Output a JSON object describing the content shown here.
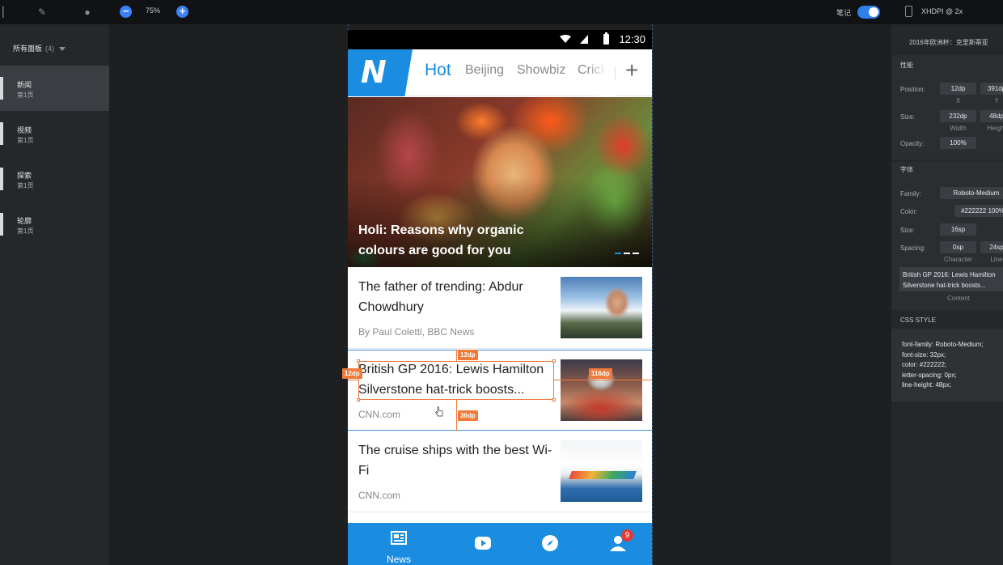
{
  "toolbar": {
    "zoom": "75%",
    "notes_label": "笔记"
  },
  "left_panel": {
    "header": "所有面板",
    "count": "(4)",
    "boards": [
      {
        "name": "新闻",
        "page": "第1页"
      },
      {
        "name": "视频",
        "page": "第1页"
      },
      {
        "name": "探索",
        "page": "第1页"
      },
      {
        "name": "轮廓",
        "page": "第1页"
      }
    ]
  },
  "right_panel": {
    "device": "XHDPI @ 2x",
    "title": "2016年欧洲杯：克里斯蒂亚",
    "props_section": "性能",
    "position_label": "Position:",
    "position_x": "12dp",
    "position_y": "391dp",
    "x_label": "X",
    "y_label": "Y",
    "size_label": "Size:",
    "size_w": "232dp",
    "size_h": "48dp",
    "width_label": "Width",
    "height_label": "Height",
    "opacity_label": "Opacity:",
    "opacity": "100%",
    "font_section": "字体",
    "family_label": "Family:",
    "family": "Roboto-Medium",
    "color_label": "Color:",
    "color": "#222222 100%",
    "fsize_label": "Size:",
    "fsize": "16sp",
    "spacing_label": "Spacing:",
    "char_spacing": "0sp",
    "line_spacing": "24sp",
    "character_label": "Character",
    "line_label": "Line",
    "content_line1": "British GP 2016: Lewis Hamilton",
    "content_line2": "Silverstone hat-trick boosts...",
    "content_label": "Content",
    "css_section": "CSS STYLE",
    "css": [
      "font-family: Roboto-Medium;",
      "font-size: 32px;",
      "color: #222222;",
      "letter-spacing: 0px;",
      "line-height: 48px;"
    ]
  },
  "phone": {
    "time": "12:30",
    "logo": "N",
    "tabs": [
      "Hot",
      "Beijing",
      "Showbiz",
      "Crick"
    ],
    "plus": "+",
    "hero_title": "Holi: Reasons why organic colours are good for you",
    "news": [
      {
        "title": "The father of trending: Abdur Chowdhury",
        "source": "By Paul Coletti, BBC News"
      },
      {
        "title": "British GP 2016: Lewis Hamilton Silverstone hat-trick boosts...",
        "source": "CNN.com"
      },
      {
        "title": "The cruise ships with the best Wi-Fi",
        "source": "CNN.com"
      }
    ],
    "tabbar": {
      "news_label": "News",
      "badge": "9"
    }
  },
  "measurements": {
    "top": "12dp",
    "left": "12dp",
    "right": "116dp",
    "bottom": "36dp"
  },
  "colors": {
    "accent": "#1a8de0",
    "measure": "#f07a3a",
    "badge": "#e53935"
  }
}
